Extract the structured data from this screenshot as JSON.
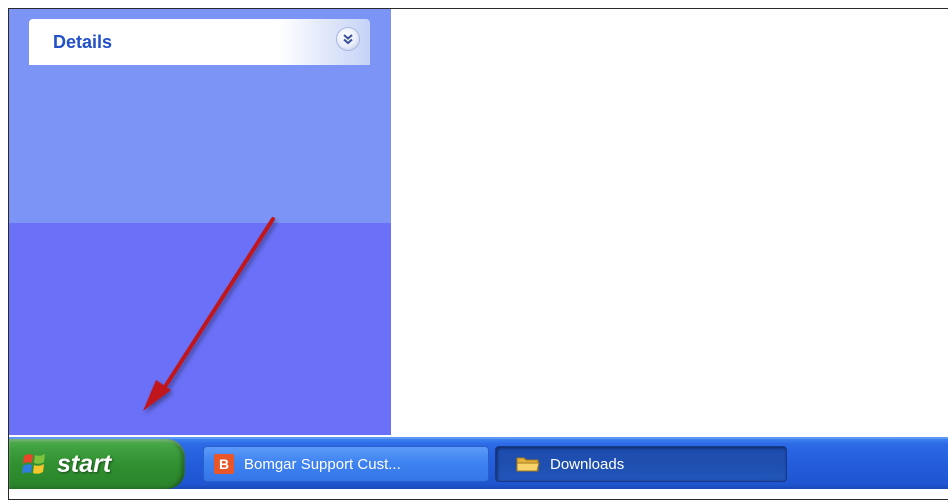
{
  "explorer": {
    "details_panel": {
      "title": "Details",
      "expand_icon": "double-chevron-down-icon"
    },
    "colors": {
      "taskpane_top": "#7b94f6",
      "taskpane_bottom": "#6a70f7",
      "details_title": "#2150c8",
      "arrow": "#c0171c"
    }
  },
  "taskbar": {
    "start_label": "start",
    "start_logo": "windows-flag-icon",
    "items": [
      {
        "label": "Bomgar Support Cust...",
        "icon": "bomgar-b-icon",
        "active": false
      },
      {
        "label": "Downloads",
        "icon": "folder-icon",
        "active": true
      }
    ],
    "colors": {
      "taskbar": "#235ddc",
      "start_button": "#3e9f3e"
    }
  }
}
